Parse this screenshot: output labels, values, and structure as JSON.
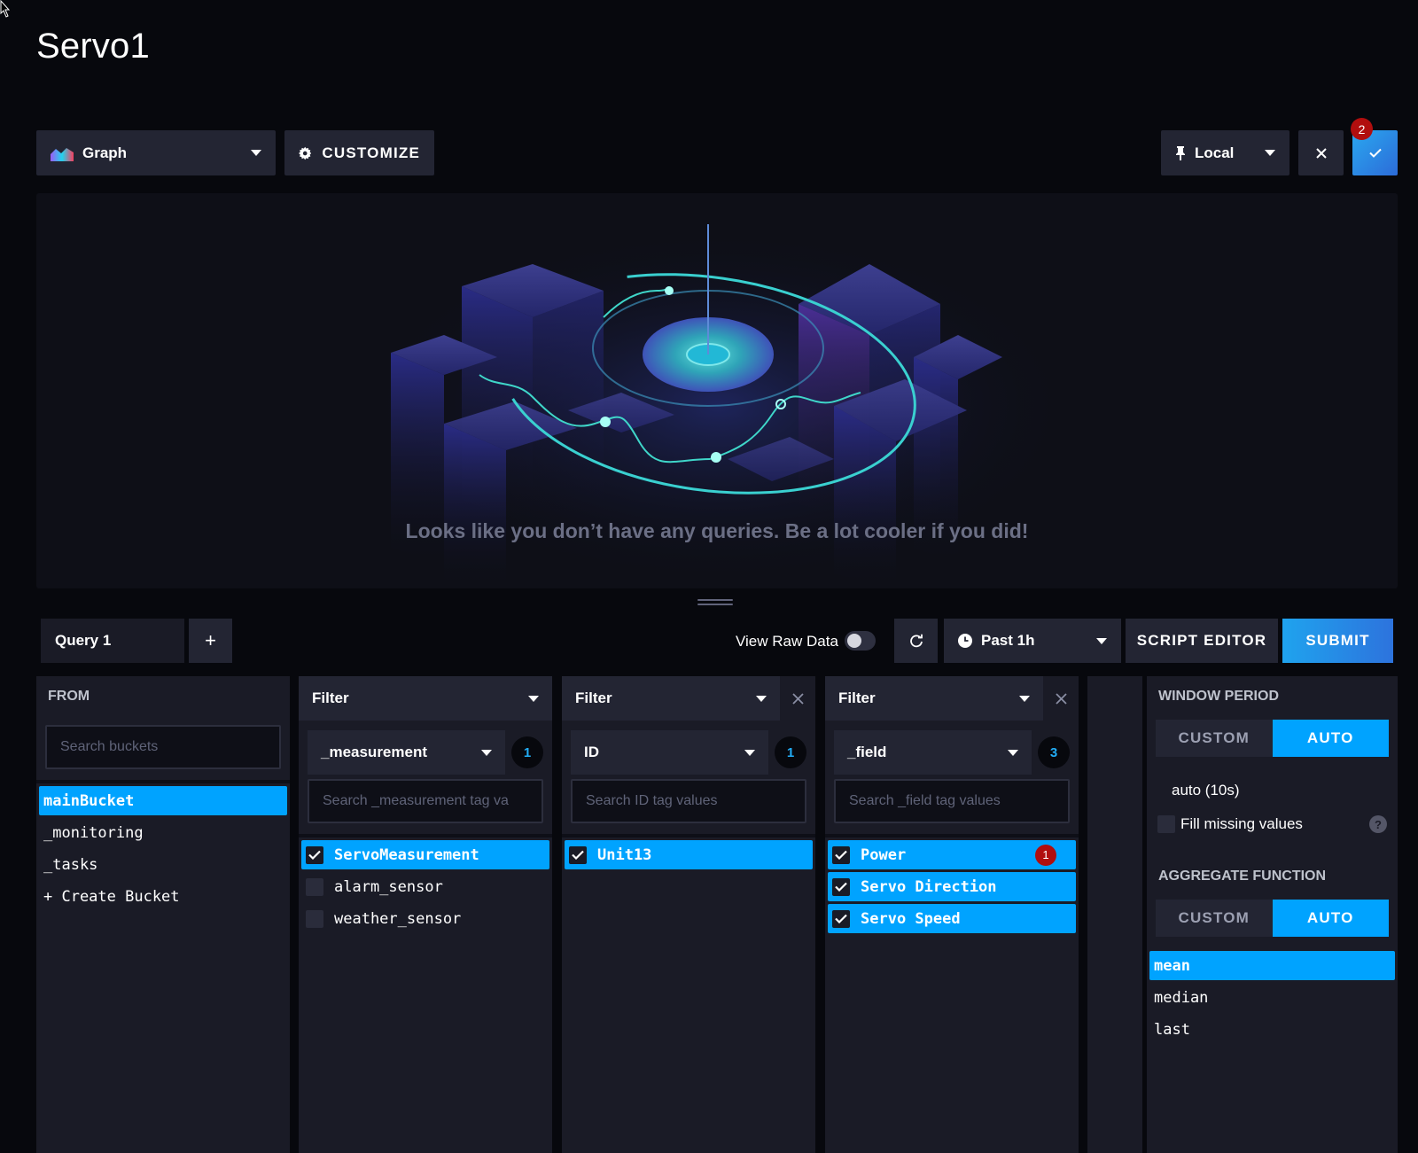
{
  "page": {
    "title": "Servo1"
  },
  "toolbar": {
    "graph_type": "Graph",
    "customize_label": "CUSTOMIZE",
    "timezone": "Local",
    "cancel_icon": "close-icon",
    "confirm_icon": "check-icon",
    "confirm_badge": "2"
  },
  "viz": {
    "empty_message": "Looks like you don’t have any queries. Be a lot cooler if you did!"
  },
  "query_bar": {
    "tab_label": "Query 1",
    "add_label": "+",
    "view_raw_label": "View Raw Data",
    "view_raw_enabled": false,
    "time_range": "Past 1h",
    "script_editor_label": "SCRIPT EDITOR",
    "submit_label": "SUBMIT"
  },
  "from": {
    "title": "FROM",
    "search_placeholder": "Search buckets",
    "buckets": [
      {
        "label": "mainBucket",
        "selected": true
      },
      {
        "label": "_monitoring",
        "selected": false
      },
      {
        "label": "_tasks",
        "selected": false
      },
      {
        "label": "+ Create Bucket",
        "selected": false
      }
    ]
  },
  "filters": [
    {
      "header": "Filter",
      "key": "_measurement",
      "count": "1",
      "search_placeholder": "Search _measurement tag va",
      "values": [
        {
          "label": "ServoMeasurement",
          "checked": true
        },
        {
          "label": "alarm_sensor",
          "checked": false
        },
        {
          "label": "weather_sensor",
          "checked": false
        }
      ]
    },
    {
      "header": "Filter",
      "key": "ID",
      "count": "1",
      "search_placeholder": "Search ID tag values",
      "values": [
        {
          "label": "Unit13",
          "checked": true
        }
      ]
    },
    {
      "header": "Filter",
      "key": "_field",
      "count": "3",
      "search_placeholder": "Search _field tag values",
      "values": [
        {
          "label": "Power",
          "checked": true,
          "badge": "1"
        },
        {
          "label": "Servo Direction",
          "checked": true
        },
        {
          "label": "Servo Speed",
          "checked": true
        }
      ]
    }
  ],
  "aggregate": {
    "window_title": "WINDOW PERIOD",
    "window_custom": "CUSTOM",
    "window_auto": "AUTO",
    "window_value": "auto (10s)",
    "fill_label": "Fill missing values",
    "function_title": "AGGREGATE FUNCTION",
    "function_custom": "CUSTOM",
    "function_auto": "AUTO",
    "functions": [
      {
        "label": "mean",
        "selected": true
      },
      {
        "label": "median",
        "selected": false
      },
      {
        "label": "last",
        "selected": false
      }
    ]
  },
  "colors": {
    "accent": "#00a3ff",
    "alert": "#b10e0e",
    "panel": "#1a1b26",
    "background": "#07080d"
  }
}
